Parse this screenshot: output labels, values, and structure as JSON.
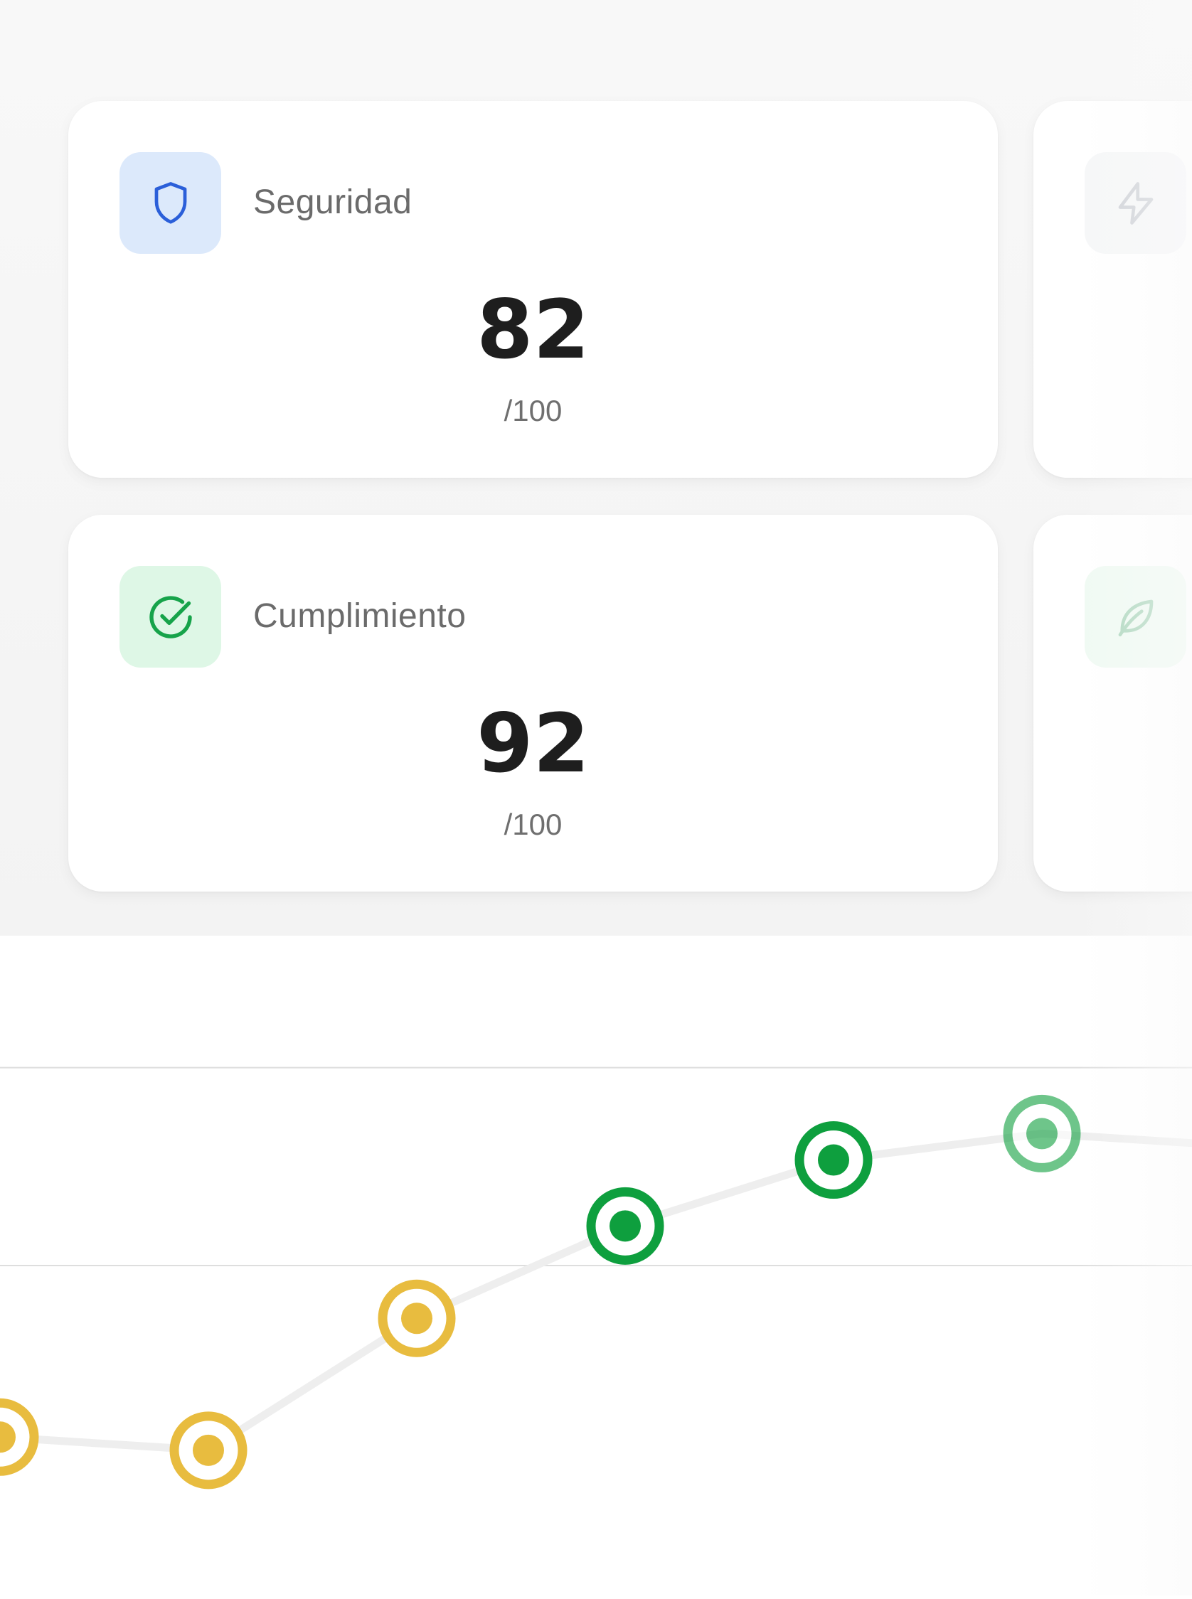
{
  "cards": [
    {
      "label": "Seguridad",
      "value": "82",
      "unit": "/100",
      "icon": "shield-icon",
      "accent": "#2b5fd9",
      "bg": "#dce9fb"
    },
    {
      "label": "Cumplimiento",
      "value": "92",
      "unit": "/100",
      "icon": "check-circle-icon",
      "accent": "#16a34a",
      "bg": "#def7e6"
    }
  ],
  "side_cards": [
    {
      "icon": "lightning-icon",
      "color": "#b8bcc6",
      "bg": "#f0f1f4"
    },
    {
      "icon": "leaf-icon",
      "color": "#7fc79a",
      "bg": "#e4f6ea"
    }
  ],
  "chart_data": {
    "type": "line",
    "points": [
      {
        "value": 52,
        "status": "warning"
      },
      {
        "value": 51,
        "status": "warning"
      },
      {
        "value": 61,
        "status": "warning"
      },
      {
        "value": 68,
        "status": "good"
      },
      {
        "value": 73,
        "status": "good"
      },
      {
        "value": 75,
        "status": "good"
      },
      {
        "value": 74,
        "status": "good"
      }
    ],
    "ylim": [
      40,
      90
    ],
    "gridlines": [
      80,
      65
    ],
    "colors": {
      "warning": "#e8bc3f",
      "good": "#0e9f3e",
      "line": "#eeeeee",
      "grid": "#dedede"
    }
  }
}
